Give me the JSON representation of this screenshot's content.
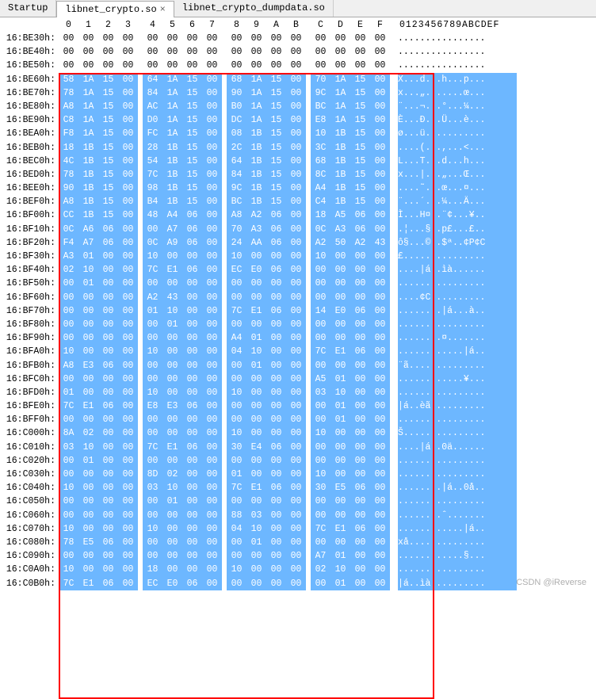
{
  "tabs": [
    {
      "label": "Startup",
      "active": false,
      "closable": false
    },
    {
      "label": "libnet_crypto.so",
      "active": true,
      "closable": true
    },
    {
      "label": "libnet_crypto_dumpdata.so",
      "active": false,
      "closable": false
    }
  ],
  "header_hex": [
    "0",
    "1",
    "2",
    "3",
    "4",
    "5",
    "6",
    "7",
    "8",
    "9",
    "A",
    "B",
    "C",
    "D",
    "E",
    "F"
  ],
  "header_ascii": "0123456789ABCDEF",
  "addr_prefix": "16:",
  "rows": [
    {
      "addr": "BE30h:",
      "sel": false,
      "b": [
        "00",
        "00",
        "00",
        "00",
        "00",
        "00",
        "00",
        "00",
        "00",
        "00",
        "00",
        "00",
        "00",
        "00",
        "00",
        "00"
      ],
      "ascii": "................"
    },
    {
      "addr": "BE40h:",
      "sel": false,
      "b": [
        "00",
        "00",
        "00",
        "00",
        "00",
        "00",
        "00",
        "00",
        "00",
        "00",
        "00",
        "00",
        "00",
        "00",
        "00",
        "00"
      ],
      "ascii": "................"
    },
    {
      "addr": "BE50h:",
      "sel": false,
      "b": [
        "00",
        "00",
        "00",
        "00",
        "00",
        "00",
        "00",
        "00",
        "00",
        "00",
        "00",
        "00",
        "00",
        "00",
        "00",
        "00"
      ],
      "ascii": "................"
    },
    {
      "addr": "BE60h:",
      "sel": true,
      "b": [
        "58",
        "1A",
        "15",
        "00",
        "64",
        "1A",
        "15",
        "00",
        "68",
        "1A",
        "15",
        "00",
        "70",
        "1A",
        "15",
        "00"
      ],
      "ascii": "X...d...h...p..."
    },
    {
      "addr": "BE70h:",
      "sel": true,
      "b": [
        "78",
        "1A",
        "15",
        "00",
        "84",
        "1A",
        "15",
        "00",
        "90",
        "1A",
        "15",
        "00",
        "9C",
        "1A",
        "15",
        "00"
      ],
      "ascii": "x...„.......œ..."
    },
    {
      "addr": "BE80h:",
      "sel": true,
      "b": [
        "A8",
        "1A",
        "15",
        "00",
        "AC",
        "1A",
        "15",
        "00",
        "B0",
        "1A",
        "15",
        "00",
        "BC",
        "1A",
        "15",
        "00"
      ],
      "ascii": "¨...¬...°...¼..."
    },
    {
      "addr": "BE90h:",
      "sel": true,
      "b": [
        "C8",
        "1A",
        "15",
        "00",
        "D0",
        "1A",
        "15",
        "00",
        "DC",
        "1A",
        "15",
        "00",
        "E8",
        "1A",
        "15",
        "00"
      ],
      "ascii": "È...Ð...Ü...è..."
    },
    {
      "addr": "BEA0h:",
      "sel": true,
      "b": [
        "F8",
        "1A",
        "15",
        "00",
        "FC",
        "1A",
        "15",
        "00",
        "08",
        "1B",
        "15",
        "00",
        "10",
        "1B",
        "15",
        "00"
      ],
      "ascii": "ø...ü..........."
    },
    {
      "addr": "BEB0h:",
      "sel": true,
      "b": [
        "18",
        "1B",
        "15",
        "00",
        "28",
        "1B",
        "15",
        "00",
        "2C",
        "1B",
        "15",
        "00",
        "3C",
        "1B",
        "15",
        "00"
      ],
      "ascii": "....(...,...<..."
    },
    {
      "addr": "BEC0h:",
      "sel": true,
      "b": [
        "4C",
        "1B",
        "15",
        "00",
        "54",
        "1B",
        "15",
        "00",
        "64",
        "1B",
        "15",
        "00",
        "68",
        "1B",
        "15",
        "00"
      ],
      "ascii": "L...T...d...h..."
    },
    {
      "addr": "BED0h:",
      "sel": true,
      "b": [
        "78",
        "1B",
        "15",
        "00",
        "7C",
        "1B",
        "15",
        "00",
        "84",
        "1B",
        "15",
        "00",
        "8C",
        "1B",
        "15",
        "00"
      ],
      "ascii": "x...|...„...Œ..."
    },
    {
      "addr": "BEE0h:",
      "sel": true,
      "b": [
        "90",
        "1B",
        "15",
        "00",
        "98",
        "1B",
        "15",
        "00",
        "9C",
        "1B",
        "15",
        "00",
        "A4",
        "1B",
        "15",
        "00"
      ],
      "ascii": "....˜...œ...¤..."
    },
    {
      "addr": "BEF0h:",
      "sel": true,
      "b": [
        "A8",
        "1B",
        "15",
        "00",
        "B4",
        "1B",
        "15",
        "00",
        "BC",
        "1B",
        "15",
        "00",
        "C4",
        "1B",
        "15",
        "00"
      ],
      "ascii": "¨...´...¼...Ä..."
    },
    {
      "addr": "BF00h:",
      "sel": true,
      "b": [
        "CC",
        "1B",
        "15",
        "00",
        "48",
        "A4",
        "06",
        "00",
        "A8",
        "A2",
        "06",
        "00",
        "18",
        "A5",
        "06",
        "00"
      ],
      "ascii": "Ì...H¤..¨¢...¥.."
    },
    {
      "addr": "BF10h:",
      "sel": true,
      "b": [
        "0C",
        "A6",
        "06",
        "00",
        "00",
        "A7",
        "06",
        "00",
        "70",
        "A3",
        "06",
        "00",
        "0C",
        "A3",
        "06",
        "00"
      ],
      "ascii": ".¦...§..p£...£.."
    },
    {
      "addr": "BF20h:",
      "sel": true,
      "b": [
        "F4",
        "A7",
        "06",
        "00",
        "0C",
        "A9",
        "06",
        "00",
        "24",
        "AA",
        "06",
        "00",
        "A2",
        "50",
        "A2",
        "43"
      ],
      "ascii": "ô§...©..$ª..¢P¢C"
    },
    {
      "addr": "BF30h:",
      "sel": true,
      "b": [
        "A3",
        "01",
        "00",
        "00",
        "10",
        "00",
        "00",
        "00",
        "10",
        "00",
        "00",
        "00",
        "10",
        "00",
        "00",
        "00"
      ],
      "ascii": "£..............."
    },
    {
      "addr": "BF40h:",
      "sel": true,
      "b": [
        "02",
        "10",
        "00",
        "00",
        "7C",
        "E1",
        "06",
        "00",
        "EC",
        "E0",
        "06",
        "00",
        "00",
        "00",
        "00",
        "00"
      ],
      "ascii": "....|á..ìà......"
    },
    {
      "addr": "BF50h:",
      "sel": true,
      "b": [
        "00",
        "01",
        "00",
        "00",
        "00",
        "00",
        "00",
        "00",
        "00",
        "00",
        "00",
        "00",
        "00",
        "00",
        "00",
        "00"
      ],
      "ascii": "................"
    },
    {
      "addr": "BF60h:",
      "sel": true,
      "b": [
        "00",
        "00",
        "00",
        "00",
        "A2",
        "43",
        "00",
        "00",
        "00",
        "00",
        "00",
        "00",
        "00",
        "00",
        "00",
        "00"
      ],
      "ascii": "....¢C.........."
    },
    {
      "addr": "BF70h:",
      "sel": true,
      "b": [
        "00",
        "00",
        "00",
        "00",
        "01",
        "10",
        "00",
        "00",
        "7C",
        "E1",
        "06",
        "00",
        "14",
        "E0",
        "06",
        "00"
      ],
      "ascii": "........|á...à.."
    },
    {
      "addr": "BF80h:",
      "sel": true,
      "b": [
        "00",
        "00",
        "00",
        "00",
        "00",
        "01",
        "00",
        "00",
        "00",
        "00",
        "00",
        "00",
        "00",
        "00",
        "00",
        "00"
      ],
      "ascii": "................"
    },
    {
      "addr": "BF90h:",
      "sel": true,
      "b": [
        "00",
        "00",
        "00",
        "00",
        "00",
        "00",
        "00",
        "00",
        "A4",
        "01",
        "00",
        "00",
        "00",
        "00",
        "00",
        "00"
      ],
      "ascii": "........¤......."
    },
    {
      "addr": "BFA0h:",
      "sel": true,
      "b": [
        "10",
        "00",
        "00",
        "00",
        "10",
        "00",
        "00",
        "00",
        "04",
        "10",
        "00",
        "00",
        "7C",
        "E1",
        "06",
        "00"
      ],
      "ascii": "............|á.."
    },
    {
      "addr": "BFB0h:",
      "sel": true,
      "b": [
        "A8",
        "E3",
        "06",
        "00",
        "00",
        "00",
        "00",
        "00",
        "00",
        "01",
        "00",
        "00",
        "00",
        "00",
        "00",
        "00"
      ],
      "ascii": "¨ã.............."
    },
    {
      "addr": "BFC0h:",
      "sel": true,
      "b": [
        "00",
        "00",
        "00",
        "00",
        "00",
        "00",
        "00",
        "00",
        "00",
        "00",
        "00",
        "00",
        "A5",
        "01",
        "00",
        "00"
      ],
      "ascii": "............¥..."
    },
    {
      "addr": "BFD0h:",
      "sel": true,
      "b": [
        "01",
        "00",
        "00",
        "00",
        "10",
        "00",
        "00",
        "00",
        "10",
        "00",
        "00",
        "00",
        "03",
        "10",
        "00",
        "00"
      ],
      "ascii": "................"
    },
    {
      "addr": "BFE0h:",
      "sel": true,
      "b": [
        "7C",
        "E1",
        "06",
        "00",
        "E8",
        "E3",
        "06",
        "00",
        "00",
        "00",
        "00",
        "00",
        "00",
        "01",
        "00",
        "00"
      ],
      "ascii": "|á..èã.........."
    },
    {
      "addr": "BFF0h:",
      "sel": true,
      "b": [
        "00",
        "00",
        "00",
        "00",
        "00",
        "00",
        "00",
        "00",
        "00",
        "00",
        "00",
        "00",
        "00",
        "01",
        "00",
        "00"
      ],
      "ascii": "................"
    },
    {
      "addr": "C000h:",
      "sel": true,
      "b": [
        "8A",
        "02",
        "00",
        "00",
        "00",
        "00",
        "00",
        "00",
        "10",
        "00",
        "00",
        "00",
        "10",
        "00",
        "00",
        "00"
      ],
      "ascii": "Š..............."
    },
    {
      "addr": "C010h:",
      "sel": true,
      "b": [
        "03",
        "10",
        "00",
        "00",
        "7C",
        "E1",
        "06",
        "00",
        "30",
        "E4",
        "06",
        "00",
        "00",
        "00",
        "00",
        "00"
      ],
      "ascii": "....|á..0ä......"
    },
    {
      "addr": "C020h:",
      "sel": true,
      "b": [
        "00",
        "01",
        "00",
        "00",
        "00",
        "00",
        "00",
        "00",
        "00",
        "00",
        "00",
        "00",
        "00",
        "00",
        "00",
        "00"
      ],
      "ascii": "................"
    },
    {
      "addr": "C030h:",
      "sel": true,
      "b": [
        "00",
        "00",
        "00",
        "00",
        "8D",
        "02",
        "00",
        "00",
        "01",
        "00",
        "00",
        "00",
        "10",
        "00",
        "00",
        "00"
      ],
      "ascii": "................"
    },
    {
      "addr": "C040h:",
      "sel": true,
      "b": [
        "10",
        "00",
        "00",
        "00",
        "03",
        "10",
        "00",
        "00",
        "7C",
        "E1",
        "06",
        "00",
        "30",
        "E5",
        "06",
        "00"
      ],
      "ascii": "........|á..0å.."
    },
    {
      "addr": "C050h:",
      "sel": true,
      "b": [
        "00",
        "00",
        "00",
        "00",
        "00",
        "01",
        "00",
        "00",
        "00",
        "00",
        "00",
        "00",
        "00",
        "00",
        "00",
        "00"
      ],
      "ascii": "................"
    },
    {
      "addr": "C060h:",
      "sel": true,
      "b": [
        "00",
        "00",
        "00",
        "00",
        "00",
        "00",
        "00",
        "00",
        "88",
        "03",
        "00",
        "00",
        "00",
        "00",
        "00",
        "00"
      ],
      "ascii": "........ˆ......."
    },
    {
      "addr": "C070h:",
      "sel": true,
      "b": [
        "10",
        "00",
        "00",
        "00",
        "10",
        "00",
        "00",
        "00",
        "04",
        "10",
        "00",
        "00",
        "7C",
        "E1",
        "06",
        "00"
      ],
      "ascii": "............|á.."
    },
    {
      "addr": "C080h:",
      "sel": true,
      "b": [
        "78",
        "E5",
        "06",
        "00",
        "00",
        "00",
        "00",
        "00",
        "00",
        "01",
        "00",
        "00",
        "00",
        "00",
        "00",
        "00"
      ],
      "ascii": "xå.............."
    },
    {
      "addr": "C090h:",
      "sel": true,
      "b": [
        "00",
        "00",
        "00",
        "00",
        "00",
        "00",
        "00",
        "00",
        "00",
        "00",
        "00",
        "00",
        "A7",
        "01",
        "00",
        "00"
      ],
      "ascii": "............§..."
    },
    {
      "addr": "C0A0h:",
      "sel": true,
      "b": [
        "10",
        "00",
        "00",
        "00",
        "18",
        "00",
        "00",
        "00",
        "10",
        "00",
        "00",
        "00",
        "02",
        "10",
        "00",
        "00"
      ],
      "ascii": "................"
    },
    {
      "addr": "C0B0h:",
      "sel": true,
      "b": [
        "7C",
        "E1",
        "06",
        "00",
        "EC",
        "E0",
        "06",
        "00",
        "00",
        "00",
        "00",
        "00",
        "00",
        "01",
        "00",
        "00"
      ],
      "ascii": "|á..ìà.........."
    }
  ],
  "watermark": "CSDN @iReverse"
}
